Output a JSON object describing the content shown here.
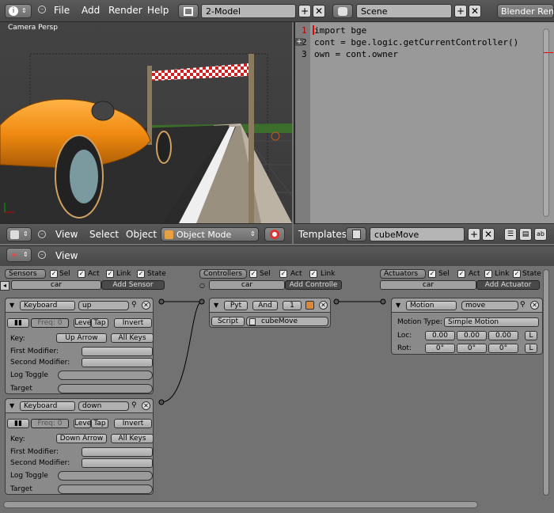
{
  "topbar": {
    "menus": [
      "File",
      "Add",
      "Render",
      "Help"
    ],
    "layout": "2-Model",
    "scene": "Scene",
    "engine": "Blender Rend"
  },
  "viewport": {
    "label": "Camera Persp"
  },
  "code": {
    "lines": [
      "1",
      "2",
      "3"
    ],
    "text": [
      "import bge",
      "cont = bge.logic.getCurrentController()",
      "own = cont.owner"
    ]
  },
  "viewhdr": {
    "view": "View",
    "select": "Select",
    "object": "Object",
    "mode": "Object Mode"
  },
  "texthdr": {
    "templates": "Templates",
    "file": "cubeMove"
  },
  "logichdr": {
    "view": "View"
  },
  "sensors": {
    "title": "Sensors",
    "sel": "Sel",
    "act": "Act",
    "link": "Link",
    "state": "State",
    "obj": "car",
    "add": "Add Sensor",
    "s1": {
      "type": "Keyboard",
      "name": "up",
      "freq": "Freq: 0",
      "level": "Level",
      "tap": "Tap",
      "invert": "Invert",
      "key_label": "Key:",
      "key": "Up Arrow",
      "all": "All Keys",
      "first": "First Modifier:",
      "second": "Second Modifier:",
      "log": "Log Toggle",
      "target": "Target"
    },
    "s2": {
      "type": "Keyboard",
      "name": "down",
      "freq": "Freq: 0",
      "level": "Level",
      "tap": "Tap",
      "invert": "Invert",
      "key_label": "Key:",
      "key": "Down Arrow",
      "all": "All Keys",
      "first": "First Modifier:",
      "second": "Second Modifier:",
      "log": "Log Toggle",
      "target": "Target"
    }
  },
  "controllers": {
    "title": "Controllers",
    "sel": "Sel",
    "act": "Act",
    "link": "Link",
    "obj": "car",
    "add": "Add Controlle",
    "c1": {
      "type": "Pyt",
      "and": "And",
      "num": "1",
      "script": "Script",
      "file": "cubeMove"
    }
  },
  "actuators": {
    "title": "Actuators",
    "sel": "Sel",
    "act": "Act",
    "link": "Link",
    "state": "State",
    "obj": "car",
    "add": "Add Actuator",
    "a1": {
      "type": "Motion",
      "name": "move",
      "mtype_label": "Motion Type:",
      "mtype": "Simple Motion",
      "loc": "Loc:",
      "rot": "Rot:",
      "locv": [
        "0.00",
        "0.00",
        "0.00"
      ],
      "rotv": [
        "0°",
        "0°",
        "0°"
      ],
      "L": "L"
    }
  }
}
